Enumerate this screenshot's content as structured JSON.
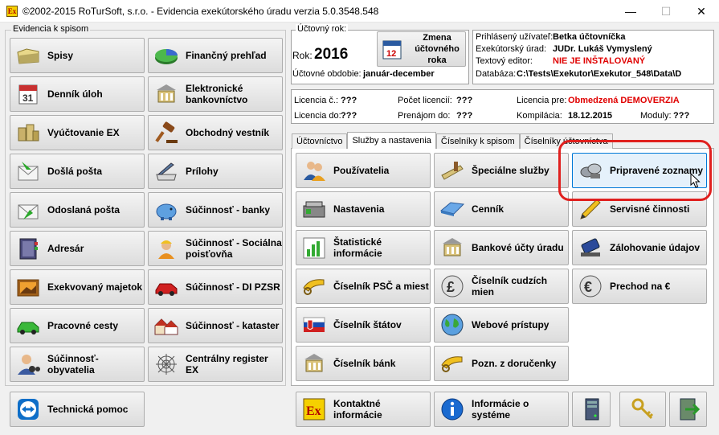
{
  "window": {
    "title": "©2002-2015 RoTurSoft, s.r.o. - Evidencia exekútorského úradu verzia 5.0.3548.548",
    "icon_label": "Ex"
  },
  "left_group": {
    "caption": "Evidencia k spisom",
    "buttons": [
      {
        "label": "Spisy",
        "icon": "folder-icon"
      },
      {
        "label": "Finančný prehľad",
        "icon": "pie-chart-icon"
      },
      {
        "label": "Denník úloh",
        "icon": "calendar-icon"
      },
      {
        "label": "Elektronické bankovníctvo",
        "icon": "bank-icon"
      },
      {
        "label": "Vyúčtovanie EX",
        "icon": "coins-icon"
      },
      {
        "label": "Obchodný vestník",
        "icon": "gavel-icon"
      },
      {
        "label": "Došlá pošta",
        "icon": "incoming-mail-icon"
      },
      {
        "label": "Prílohy",
        "icon": "scanner-icon"
      },
      {
        "label": "Odoslaná pošta",
        "icon": "outgoing-mail-icon"
      },
      {
        "label": "Súčinnosť - banky",
        "icon": "piggy-bank-icon"
      },
      {
        "label": "Adresár",
        "icon": "address-book-icon"
      },
      {
        "label": "Súčinnosť - Sociálna poisťovňa",
        "icon": "worker-icon"
      },
      {
        "label": "Exekvovaný majetok",
        "icon": "painting-icon"
      },
      {
        "label": "Súčinnosť - DI PZSR",
        "icon": "car-icon"
      },
      {
        "label": "Pracovné cesty",
        "icon": "green-car-icon"
      },
      {
        "label": "Súčinnosť - kataster",
        "icon": "houses-icon"
      },
      {
        "label": "Súčinnosť- obyvatelia",
        "icon": "person-binoculars-icon"
      },
      {
        "label": "Centrálny register EX",
        "icon": "spider-web-icon"
      }
    ]
  },
  "fiscal_year": {
    "caption": "Účtovný rok:",
    "year_label": "Rok:",
    "year": "2016",
    "period_label": "Účtovné obdobie:",
    "period": "január-december",
    "change_button": "Zmena účtovného roka"
  },
  "user_info": {
    "user_label": "Prihlásený užívateľ:",
    "user": "Betka účtovníčka",
    "office_label": "Exekútorský úrad:",
    "office": "JUDr. Lukáš Vymyslený",
    "editor_label": "Textový editor:",
    "editor": "NIE JE INŠTALOVANÝ",
    "db_label": "Databáza:",
    "db": "C:\\Tests\\Exekutor\\Exekutor_548\\Data\\D"
  },
  "license": {
    "no_label": "Licencia č.:",
    "no": "???",
    "count_label": "Počet licencií:",
    "count": "???",
    "for_label": "Licencia pre:",
    "for": "Obmedzená DEMOVERZIA",
    "to_label": "Licencia do:",
    "to": "???",
    "renew_label": "Prenájom do:",
    "renew": "???",
    "compile_label": "Kompilácia:",
    "compile": "18.12.2015",
    "modules_label": "Moduly:",
    "modules": "???"
  },
  "tabs": [
    "Účtovníctvo",
    "Služby a nastavenia",
    "Číselníky k spisom",
    "Číselníky účtovníctva"
  ],
  "active_tab": "Služby a nastavenia",
  "services": [
    {
      "label": "Používatelia",
      "icon": "users-icon"
    },
    {
      "label": "Špeciálne služby",
      "icon": "tools-icon"
    },
    {
      "label": "Pripravené zoznamy",
      "icon": "lists-icon"
    },
    {
      "label": "Nastavenia",
      "icon": "settings-box-icon"
    },
    {
      "label": "Cenník",
      "icon": "price-tag-icon"
    },
    {
      "label": "Servisné činnosti",
      "icon": "pencil-icon"
    },
    {
      "label": "Štatistické informácie",
      "icon": "bar-chart-icon"
    },
    {
      "label": "Bankové účty úradu",
      "icon": "bank-icon"
    },
    {
      "label": "Zálohovanie údajov",
      "icon": "usb-drive-icon"
    },
    {
      "label": "Číselník PSČ a miest",
      "icon": "horn-icon"
    },
    {
      "label": "Číselník cudzích mien",
      "icon": "pound-icon"
    },
    {
      "label": "Prechod na €",
      "icon": "euro-icon"
    },
    {
      "label": "Číselník štátov",
      "icon": "flag-icon"
    },
    {
      "label": "Webové prístupy",
      "icon": "globe-icon"
    },
    {
      "label": "Číselník bánk",
      "icon": "bank-icon"
    },
    {
      "label": "Pozn. z doručenky",
      "icon": "horn-icon"
    }
  ],
  "bottom": {
    "support": "Technická pomoc",
    "contacts": "Kontaktné informácie",
    "contacts_icon_label": "Ex",
    "about": "Informácie o systéme"
  }
}
